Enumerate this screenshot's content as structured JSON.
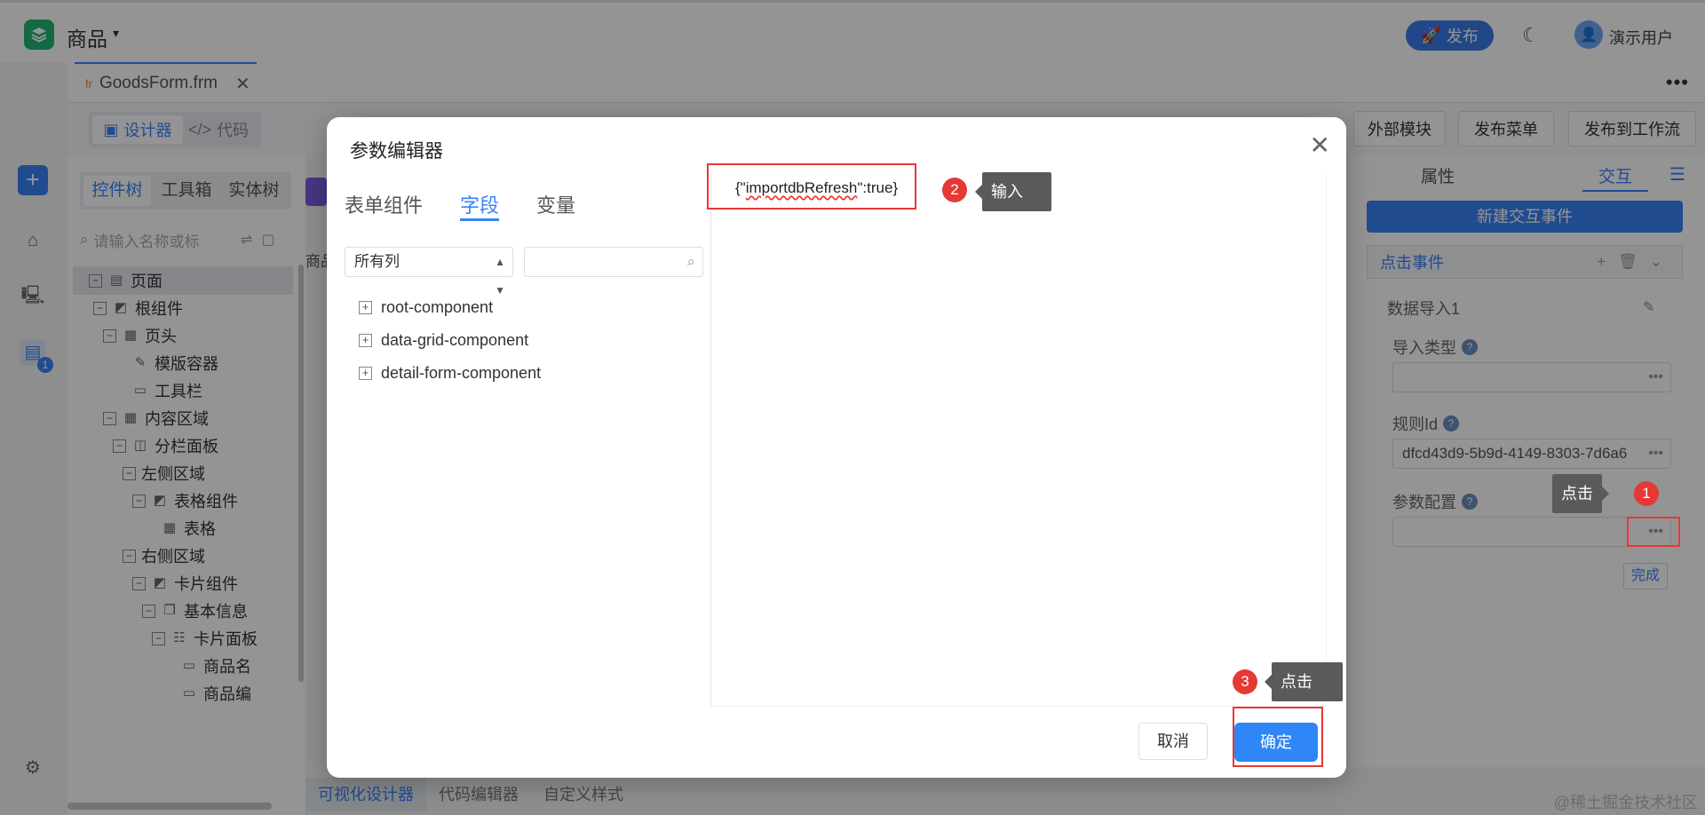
{
  "header": {
    "app_title": "商品",
    "app_caret": "▾",
    "publish_label": "发布",
    "user_name": "演示用户"
  },
  "file_tab": {
    "prefix": "fr",
    "name": "GoodsForm.frm",
    "close": "✕"
  },
  "toolbar": {
    "designer_label": "设计器",
    "code_label": "代码",
    "external_module_label": "外部模块",
    "publish_menu_label": "发布菜单",
    "publish_workflow_label": "发布到工作流"
  },
  "tree_panel": {
    "tabs": [
      "控件树",
      "工具箱",
      "实体树"
    ],
    "search_placeholder": "请输入名称或标",
    "items": [
      {
        "label": "页面",
        "level": 0,
        "icon": "page-icon"
      },
      {
        "label": "根组件",
        "level": 1,
        "icon": "component-icon"
      },
      {
        "label": "页头",
        "level": 2,
        "icon": "frame-icon"
      },
      {
        "label": "模版容器",
        "level": 3,
        "icon": "template-icon"
      },
      {
        "label": "工具栏",
        "level": 3,
        "icon": "btn-icon"
      },
      {
        "label": "内容区域",
        "level": 2,
        "icon": "frame-icon"
      },
      {
        "label": "分栏面板",
        "level": 3,
        "icon": "split-icon"
      },
      {
        "label": "左侧区域",
        "level": 4,
        "icon": ""
      },
      {
        "label": "表格组件",
        "level": 5,
        "icon": "component-icon"
      },
      {
        "label": "表格",
        "level": 6,
        "icon": "grid-icon"
      },
      {
        "label": "右侧区域",
        "level": 4,
        "icon": ""
      },
      {
        "label": "卡片组件",
        "level": 5,
        "icon": "component-icon"
      },
      {
        "label": "基本信息",
        "level": 6,
        "icon": "card-icon"
      },
      {
        "label": "卡片面板",
        "level": 7,
        "icon": "panel-icon"
      },
      {
        "label": "商品名",
        "level": 8,
        "icon": "input-icon"
      },
      {
        "label": "商品编",
        "level": 8,
        "icon": "input-icon"
      }
    ]
  },
  "canvas": {
    "strip_text": "商品"
  },
  "bottom_tabs": [
    "可视化设计器",
    "代码编辑器",
    "自定义样式"
  ],
  "watermark": "@稀土掘金技术社区",
  "right_panel": {
    "tab_props": "属性",
    "tab_interact": "交互",
    "new_event_label": "新建交互事件",
    "event_label": "点击事件",
    "action_title": "数据导入1",
    "import_type_label": "导入类型",
    "import_type_value": "",
    "rule_id_label": "规则Id",
    "rule_id_value": "dfcd43d9-5b9d-4149-8303-7d6a6",
    "param_config_label": "参数配置",
    "param_config_value": "",
    "done_label": "完成"
  },
  "modal": {
    "title": "参数编辑器",
    "tabs": [
      "表单组件",
      "字段",
      "变量"
    ],
    "active_tab": "字段",
    "select_value": "所有列",
    "tree_items": [
      "root-component",
      "data-grid-component",
      "detail-form-component"
    ],
    "code_prefix": "{\"",
    "code_key": "importdbRefresh",
    "code_suffix": "\":true}",
    "cancel_label": "取消",
    "ok_label": "确定"
  },
  "annotations": {
    "step1_num": "1",
    "step1_tip": "点击",
    "step2_num": "2",
    "step2_tip": "输入",
    "step3_num": "3",
    "step3_tip": "点击",
    "highlight_color": "#e53935"
  }
}
